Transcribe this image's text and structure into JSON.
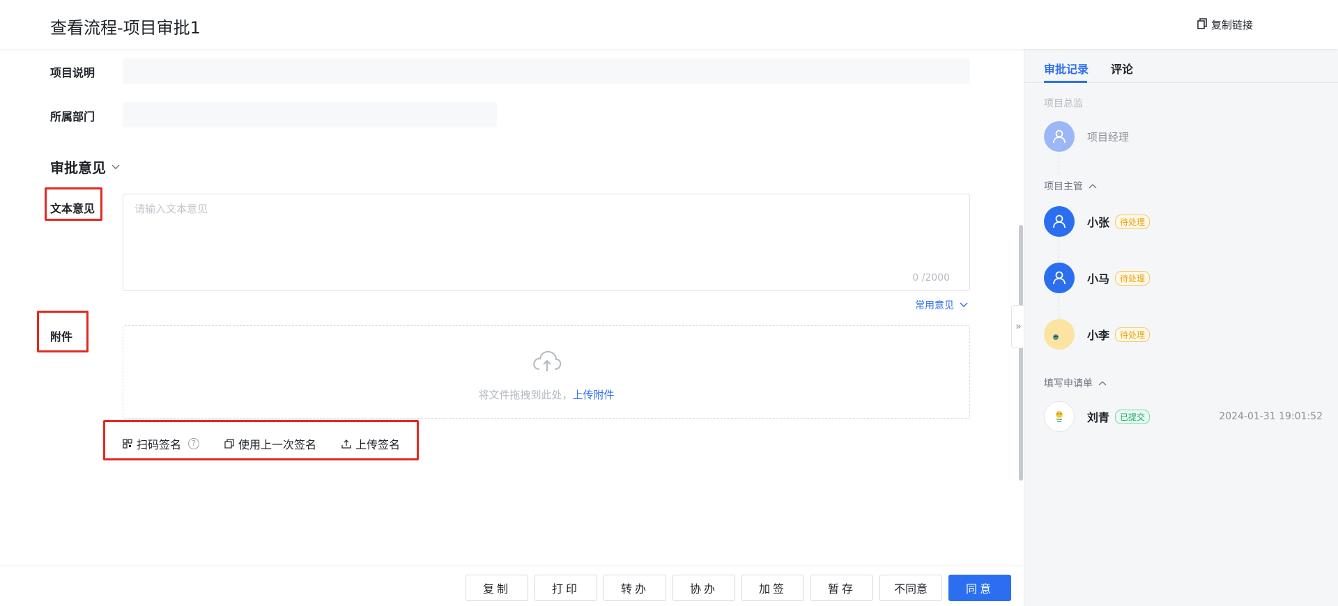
{
  "header": {
    "title": "查看流程-项目审批1",
    "copy_link_label": "复制链接"
  },
  "form": {
    "project_desc_label": "项目说明",
    "department_label": "所属部门",
    "section_title": "审批意见",
    "text_opinion_label": "文本意见",
    "text_opinion_placeholder": "请输入文本意见",
    "char_count": "0 /2000",
    "common_opinion_label": "常用意见",
    "attachment_label": "附件",
    "upload_hint": "将文件拖拽到此处，",
    "upload_link": "上传附件",
    "sign": {
      "scan_label": "扫码签名",
      "help_glyph": "?",
      "last_label": "使用上一次签名",
      "upload_label": "上传签名"
    }
  },
  "footer": {
    "buttons": [
      "复制",
      "打印",
      "转办",
      "协办",
      "加签",
      "暂存",
      "不同意",
      "同意"
    ]
  },
  "sidebar": {
    "collapse_glyph": "»",
    "tabs": [
      "审批记录",
      "评论"
    ],
    "groups": [
      {
        "title": "项目总监",
        "people": [
          {
            "name": "项目经理"
          }
        ]
      },
      {
        "title": "项目主管",
        "people": [
          {
            "name": "小张",
            "status": "待处理"
          },
          {
            "name": "小马",
            "status": "待处理"
          },
          {
            "name": "小李",
            "status": "待处理"
          }
        ]
      },
      {
        "title": "填写申请单",
        "people": [
          {
            "name": "刘青",
            "status": "已提交",
            "time": "2024-01-31 19:01:52"
          }
        ]
      }
    ]
  },
  "colors": {
    "accent": "#2b6ff0",
    "highlight_border": "#e5281f",
    "pending": "#e8a317",
    "submitted": "#17a86a"
  }
}
